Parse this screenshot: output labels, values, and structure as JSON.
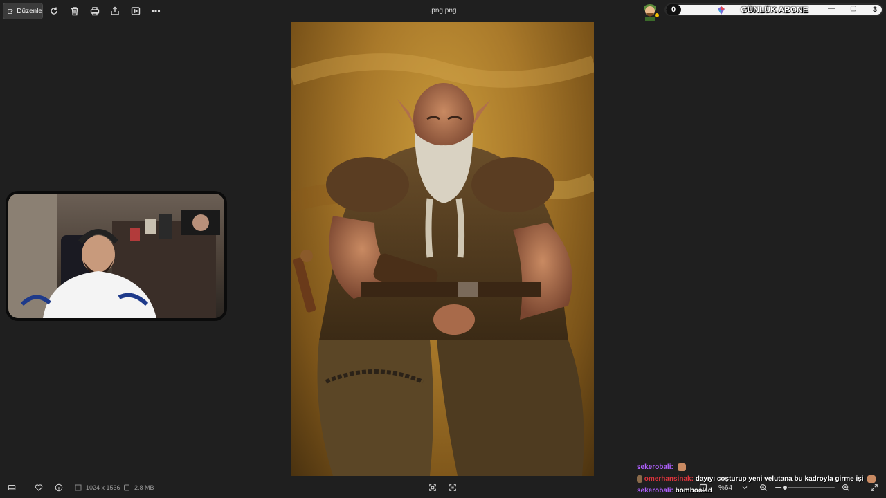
{
  "toolbar": {
    "edit_label": "Düzenle",
    "icons": [
      "edit-icon",
      "rotate-icon",
      "delete-icon",
      "print-icon",
      "share-icon",
      "slideshow-icon",
      "more-icon"
    ]
  },
  "window": {
    "title": ".png.png"
  },
  "overlay": {
    "title": "GÜNLÜK ABONE",
    "left_count": "0",
    "right_count": "3",
    "controls": [
      "—",
      "▢"
    ]
  },
  "chat": [
    {
      "user": "sekerobali:",
      "message": "",
      "user_color": "#b060ff"
    },
    {
      "user": "omerhansinak:",
      "message": "dayıyı coşturup yeni velutana bu kadroyla girme işi",
      "user_color": "#e0343d"
    },
    {
      "user": "sekerobali:",
      "message": "bomboclad",
      "user_color": "#b060ff"
    }
  ],
  "statusbar": {
    "dimensions": "1024 x 1536",
    "filesize": "2.8 MB",
    "zoom": "%64",
    "zoom_fraction": 0.16
  },
  "colors": {
    "background": "#1f1f1f",
    "accent": "#b060ff"
  }
}
